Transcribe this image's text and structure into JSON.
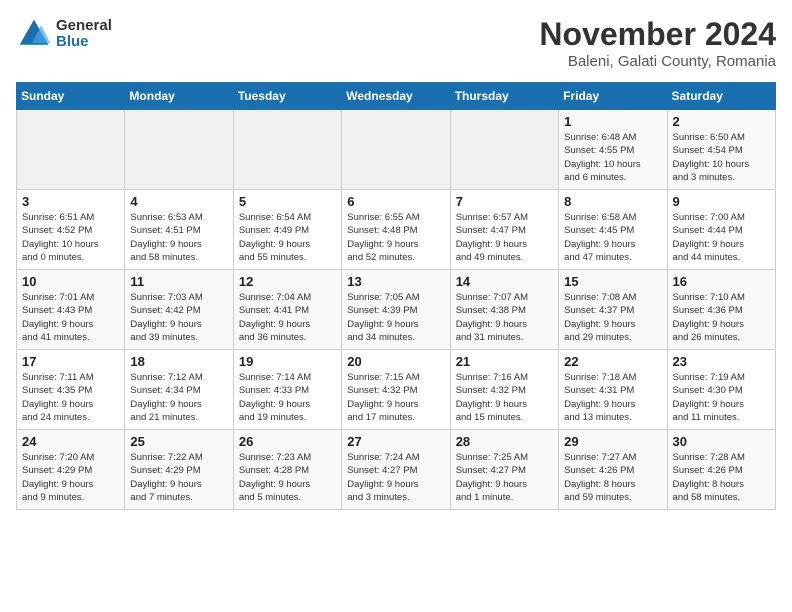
{
  "logo": {
    "general": "General",
    "blue": "Blue"
  },
  "title": "November 2024",
  "location": "Baleni, Galati County, Romania",
  "days_of_week": [
    "Sunday",
    "Monday",
    "Tuesday",
    "Wednesday",
    "Thursday",
    "Friday",
    "Saturday"
  ],
  "weeks": [
    [
      {
        "day": "",
        "info": ""
      },
      {
        "day": "",
        "info": ""
      },
      {
        "day": "",
        "info": ""
      },
      {
        "day": "",
        "info": ""
      },
      {
        "day": "",
        "info": ""
      },
      {
        "day": "1",
        "info": "Sunrise: 6:48 AM\nSunset: 4:55 PM\nDaylight: 10 hours\nand 6 minutes."
      },
      {
        "day": "2",
        "info": "Sunrise: 6:50 AM\nSunset: 4:54 PM\nDaylight: 10 hours\nand 3 minutes."
      }
    ],
    [
      {
        "day": "3",
        "info": "Sunrise: 6:51 AM\nSunset: 4:52 PM\nDaylight: 10 hours\nand 0 minutes."
      },
      {
        "day": "4",
        "info": "Sunrise: 6:53 AM\nSunset: 4:51 PM\nDaylight: 9 hours\nand 58 minutes."
      },
      {
        "day": "5",
        "info": "Sunrise: 6:54 AM\nSunset: 4:49 PM\nDaylight: 9 hours\nand 55 minutes."
      },
      {
        "day": "6",
        "info": "Sunrise: 6:55 AM\nSunset: 4:48 PM\nDaylight: 9 hours\nand 52 minutes."
      },
      {
        "day": "7",
        "info": "Sunrise: 6:57 AM\nSunset: 4:47 PM\nDaylight: 9 hours\nand 49 minutes."
      },
      {
        "day": "8",
        "info": "Sunrise: 6:58 AM\nSunset: 4:45 PM\nDaylight: 9 hours\nand 47 minutes."
      },
      {
        "day": "9",
        "info": "Sunrise: 7:00 AM\nSunset: 4:44 PM\nDaylight: 9 hours\nand 44 minutes."
      }
    ],
    [
      {
        "day": "10",
        "info": "Sunrise: 7:01 AM\nSunset: 4:43 PM\nDaylight: 9 hours\nand 41 minutes."
      },
      {
        "day": "11",
        "info": "Sunrise: 7:03 AM\nSunset: 4:42 PM\nDaylight: 9 hours\nand 39 minutes."
      },
      {
        "day": "12",
        "info": "Sunrise: 7:04 AM\nSunset: 4:41 PM\nDaylight: 9 hours\nand 36 minutes."
      },
      {
        "day": "13",
        "info": "Sunrise: 7:05 AM\nSunset: 4:39 PM\nDaylight: 9 hours\nand 34 minutes."
      },
      {
        "day": "14",
        "info": "Sunrise: 7:07 AM\nSunset: 4:38 PM\nDaylight: 9 hours\nand 31 minutes."
      },
      {
        "day": "15",
        "info": "Sunrise: 7:08 AM\nSunset: 4:37 PM\nDaylight: 9 hours\nand 29 minutes."
      },
      {
        "day": "16",
        "info": "Sunrise: 7:10 AM\nSunset: 4:36 PM\nDaylight: 9 hours\nand 26 minutes."
      }
    ],
    [
      {
        "day": "17",
        "info": "Sunrise: 7:11 AM\nSunset: 4:35 PM\nDaylight: 9 hours\nand 24 minutes."
      },
      {
        "day": "18",
        "info": "Sunrise: 7:12 AM\nSunset: 4:34 PM\nDaylight: 9 hours\nand 21 minutes."
      },
      {
        "day": "19",
        "info": "Sunrise: 7:14 AM\nSunset: 4:33 PM\nDaylight: 9 hours\nand 19 minutes."
      },
      {
        "day": "20",
        "info": "Sunrise: 7:15 AM\nSunset: 4:32 PM\nDaylight: 9 hours\nand 17 minutes."
      },
      {
        "day": "21",
        "info": "Sunrise: 7:16 AM\nSunset: 4:32 PM\nDaylight: 9 hours\nand 15 minutes."
      },
      {
        "day": "22",
        "info": "Sunrise: 7:18 AM\nSunset: 4:31 PM\nDaylight: 9 hours\nand 13 minutes."
      },
      {
        "day": "23",
        "info": "Sunrise: 7:19 AM\nSunset: 4:30 PM\nDaylight: 9 hours\nand 11 minutes."
      }
    ],
    [
      {
        "day": "24",
        "info": "Sunrise: 7:20 AM\nSunset: 4:29 PM\nDaylight: 9 hours\nand 9 minutes."
      },
      {
        "day": "25",
        "info": "Sunrise: 7:22 AM\nSunset: 4:29 PM\nDaylight: 9 hours\nand 7 minutes."
      },
      {
        "day": "26",
        "info": "Sunrise: 7:23 AM\nSunset: 4:28 PM\nDaylight: 9 hours\nand 5 minutes."
      },
      {
        "day": "27",
        "info": "Sunrise: 7:24 AM\nSunset: 4:27 PM\nDaylight: 9 hours\nand 3 minutes."
      },
      {
        "day": "28",
        "info": "Sunrise: 7:25 AM\nSunset: 4:27 PM\nDaylight: 9 hours\nand 1 minute."
      },
      {
        "day": "29",
        "info": "Sunrise: 7:27 AM\nSunset: 4:26 PM\nDaylight: 8 hours\nand 59 minutes."
      },
      {
        "day": "30",
        "info": "Sunrise: 7:28 AM\nSunset: 4:26 PM\nDaylight: 8 hours\nand 58 minutes."
      }
    ]
  ]
}
